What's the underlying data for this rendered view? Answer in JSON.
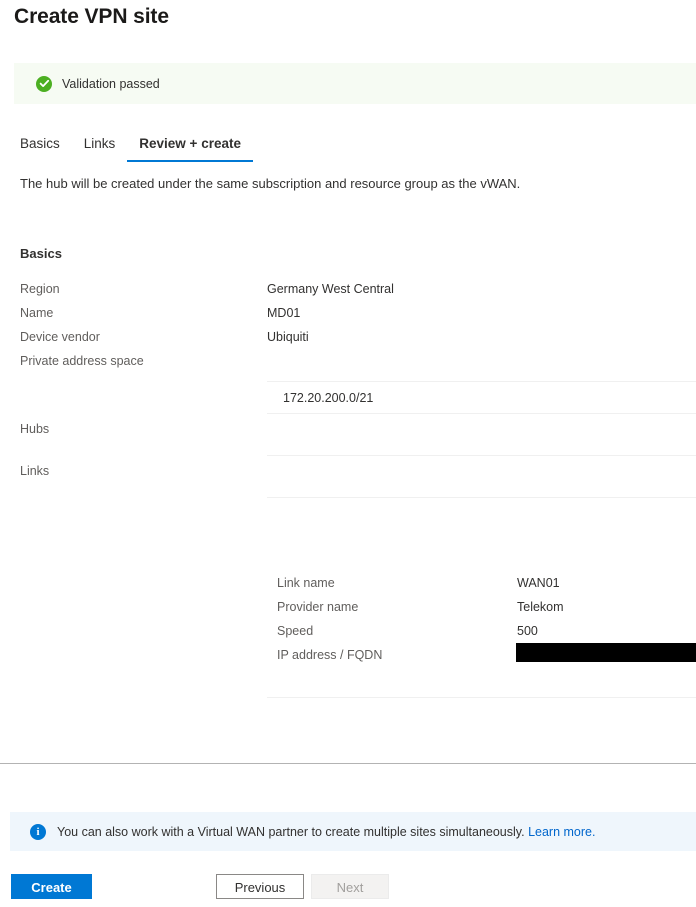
{
  "page": {
    "title": "Create VPN site"
  },
  "validation": {
    "icon": "check-circle-icon",
    "message": "Validation passed"
  },
  "tabs": [
    {
      "label": "Basics",
      "active": false
    },
    {
      "label": "Links",
      "active": false
    },
    {
      "label": "Review + create",
      "active": true
    }
  ],
  "description": "The hub will be created under the same subscription and resource group as the vWAN.",
  "sections": {
    "basics": {
      "heading": "Basics",
      "rows": [
        {
          "label": "Region",
          "value": "Germany West Central"
        },
        {
          "label": "Name",
          "value": "MD01"
        },
        {
          "label": "Device vendor",
          "value": "Ubiquiti"
        },
        {
          "label": "Private address space",
          "value": ""
        }
      ],
      "address_space_value": "172.20.200.0/21"
    },
    "hubs": {
      "label": "Hubs"
    },
    "links": {
      "label": "Links",
      "rows": [
        {
          "label": "Link name",
          "value": "WAN01"
        },
        {
          "label": "Provider name",
          "value": "Telekom"
        },
        {
          "label": "Speed",
          "value": "500"
        },
        {
          "label": "IP address / FQDN",
          "value": "",
          "redacted": true
        }
      ]
    }
  },
  "info": {
    "icon": "info-circle-icon",
    "message": "You can also work with a Virtual WAN partner to create multiple sites simultaneously.",
    "link_label": "Learn more."
  },
  "actions": {
    "create_label": "Create",
    "previous_label": "Previous",
    "next_label": "Next"
  },
  "colors": {
    "accent": "#0078d4",
    "success": "#4caf22",
    "validation_bg": "#f6fbf3",
    "info_bg": "#eff6fc",
    "label_text": "#605e5c"
  }
}
